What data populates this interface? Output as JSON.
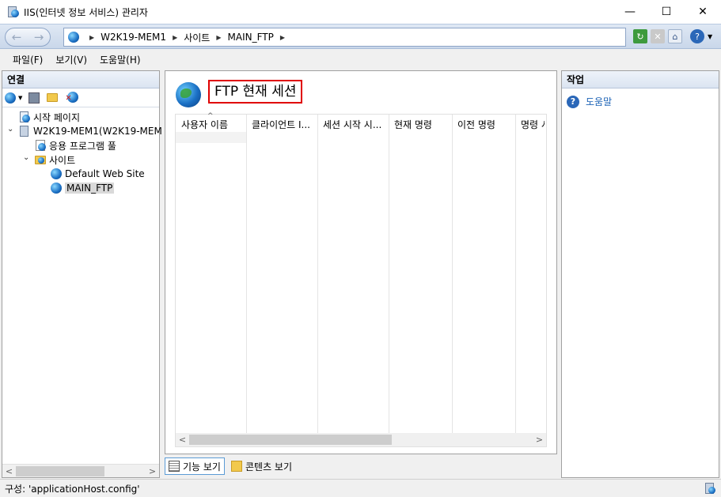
{
  "window": {
    "title": "IIS(인터넷 정보 서비스) 관리자",
    "minimize": "—",
    "maximize": "☐",
    "close": "✕"
  },
  "nav": {
    "back": "←",
    "forward": "→",
    "breadcrumb": [
      "W2K19-MEM1",
      "사이트",
      "MAIN_FTP"
    ],
    "sep": "▶"
  },
  "menu": [
    "파일(F)",
    "보기(V)",
    "도움말(H)"
  ],
  "connections": {
    "header": "연결",
    "tree": [
      {
        "label": "시작 페이지",
        "icon": "start-page-icon"
      },
      {
        "label": "W2K19-MEM1(W2K19-MEM",
        "icon": "server-icon"
      },
      {
        "label": "응용 프로그램 풀",
        "icon": "app-pool-icon"
      },
      {
        "label": "사이트",
        "icon": "sites-folder-icon"
      },
      {
        "label": "Default Web Site",
        "icon": "website-globe-icon"
      },
      {
        "label": "MAIN_FTP",
        "icon": "ftp-site-globe-icon"
      }
    ]
  },
  "main": {
    "title": "FTP 현재 세션",
    "columns": [
      "사용자 이름",
      "클라이언트 I...",
      "세션 시작 시...",
      "현재 명령",
      "이전 명령",
      "명령 시"
    ],
    "view_tabs": [
      "기능 보기",
      "콘텐츠 보기"
    ]
  },
  "actions": {
    "header": "작업",
    "items": [
      "도움말"
    ]
  },
  "status": {
    "text": "구성: 'applicationHost.config'"
  },
  "colors": {
    "highlight_border": "#e00000",
    "link": "#1a61b5"
  }
}
